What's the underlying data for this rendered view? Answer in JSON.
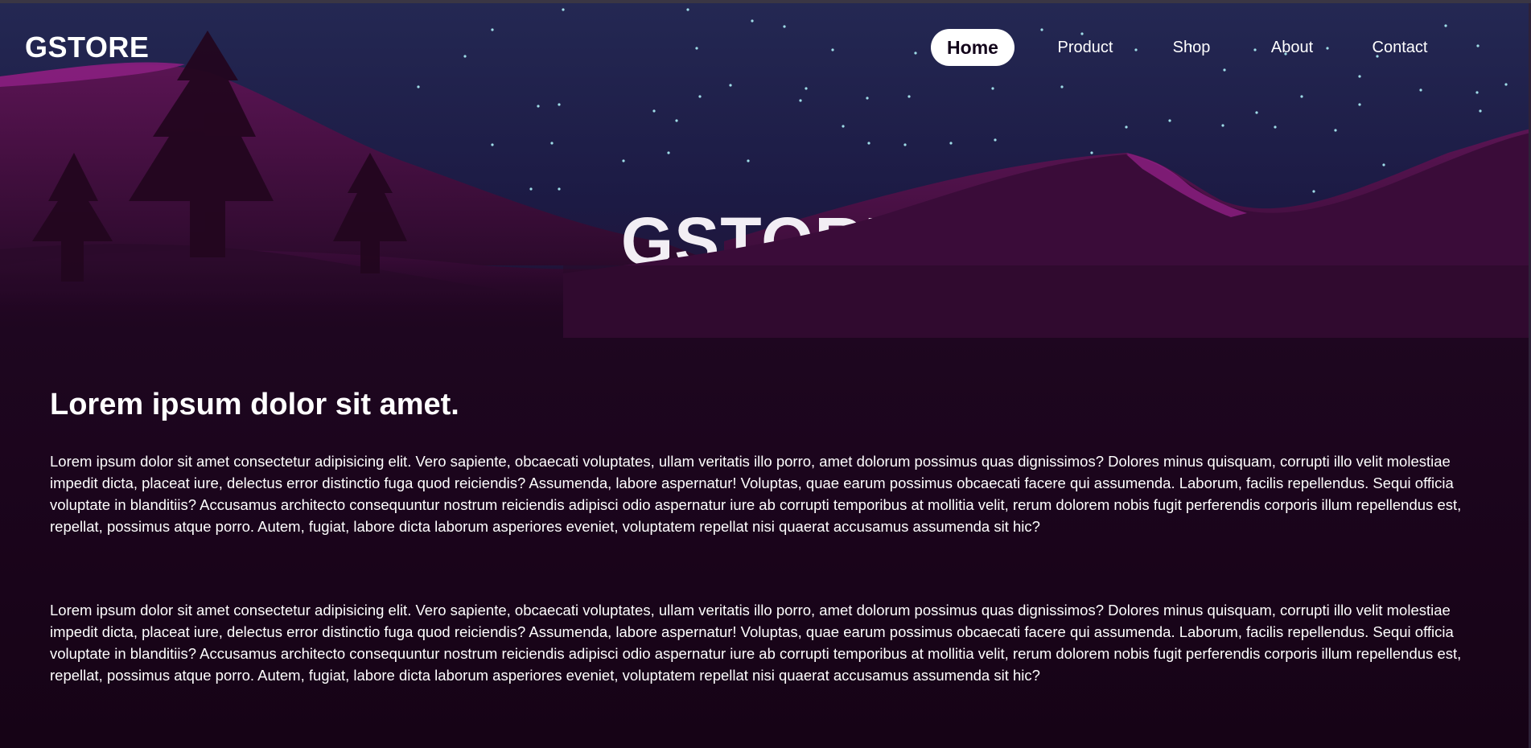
{
  "brand": {
    "logo_text": "GSTORE"
  },
  "nav": {
    "items": [
      {
        "label": "Home",
        "active": true
      },
      {
        "label": "Product",
        "active": false
      },
      {
        "label": "Shop",
        "active": false
      },
      {
        "label": "About",
        "active": false
      },
      {
        "label": "Contact",
        "active": false
      }
    ]
  },
  "hero": {
    "title": "GSTORE"
  },
  "main": {
    "heading": "Lorem ipsum dolor sit amet.",
    "paragraphs": [
      "Lorem ipsum dolor sit amet consectetur adipisicing elit. Vero sapiente, obcaecati voluptates, ullam veritatis illo porro, amet dolorum possimus quas dignissimos? Dolores minus quisquam, corrupti illo velit molestiae impedit dicta, placeat iure, delectus error distinctio fuga quod reiciendis? Assumenda, labore aspernatur! Voluptas, quae earum possimus obcaecati facere qui assumenda. Laborum, facilis repellendus. Sequi officia voluptate in blanditiis? Accusamus architecto consequuntur nostrum reiciendis adipisci odio aspernatur iure ab corrupti temporibus at mollitia velit, rerum dolorem nobis fugit perferendis corporis illum repellendus est, repellat, possimus atque porro. Autem, fugiat, labore dicta laborum asperiores eveniet, voluptatem repellat nisi quaerat accusamus assumenda sit hic?",
      "Lorem ipsum dolor sit amet consectetur adipisicing elit. Vero sapiente, obcaecati voluptates, ullam veritatis illo porro, amet dolorum possimus quas dignissimos? Dolores minus quisquam, corrupti illo velit molestiae impedit dicta, placeat iure, delectus error distinctio fuga quod reiciendis? Assumenda, labore aspernatur! Voluptas, quae earum possimus obcaecati facere qui assumenda. Laborum, facilis repellendus. Sequi officia voluptate in blanditiis? Accusamus architecto consequuntur nostrum reiciendis adipisci odio aspernatur iure ab corrupti temporibus at mollitia velit, rerum dolorem nobis fugit perferendis corporis illum repellendus est, repellat, possimus atque porro. Autem, fugiat, labore dicta laborum asperiores eveniet, voluptatem repellat nisi quaerat accusamus assumenda sit hic?"
    ]
  },
  "colors": {
    "sky": "#1f2148",
    "hills_far": "#4e1148",
    "hills_near": "#2a0a2a",
    "background": "#1b0419",
    "accent_pink": "#8a1f7f"
  }
}
